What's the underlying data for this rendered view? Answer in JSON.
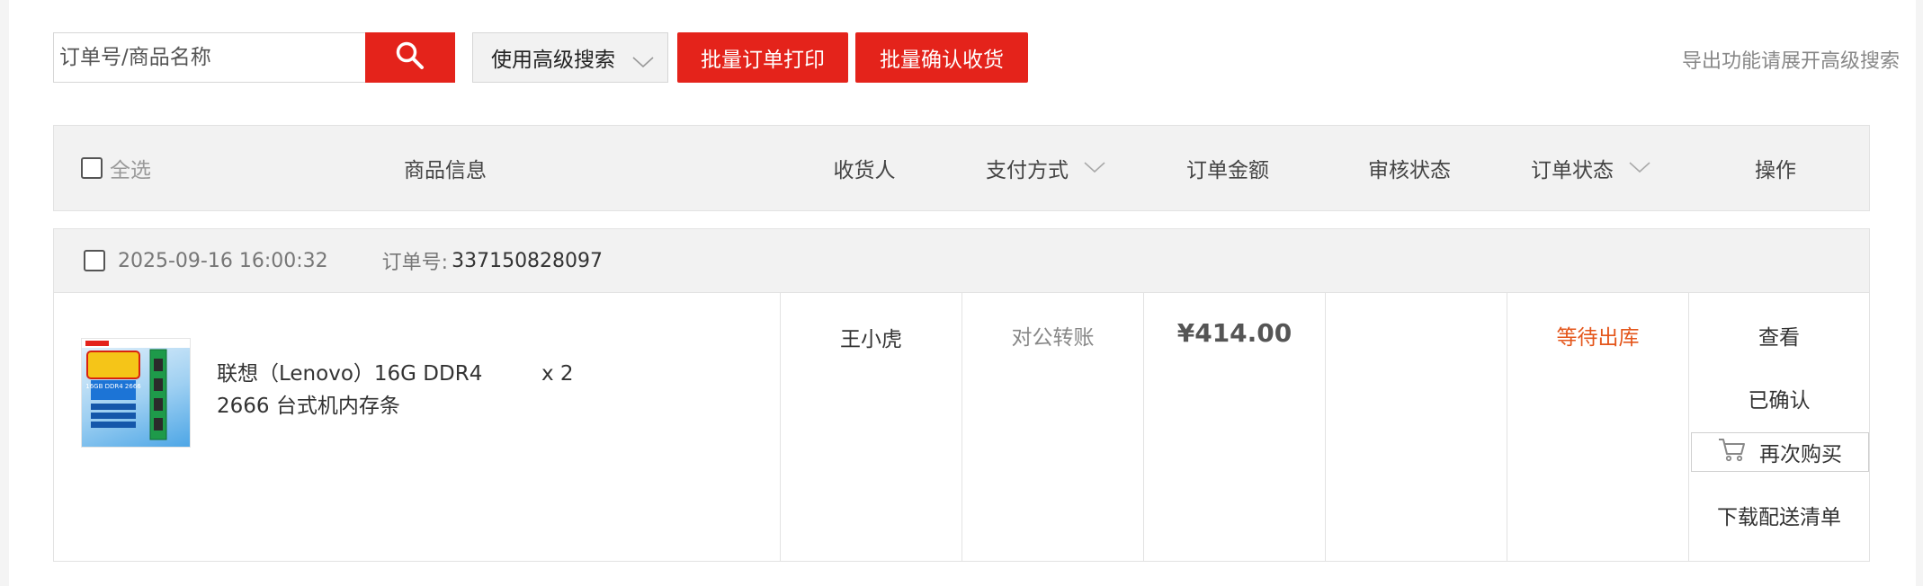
{
  "toolbar": {
    "search_placeholder": "订单号/商品名称",
    "advanced_search_label": "使用高级搜索",
    "batch_print_label": "批量订单打印",
    "batch_confirm_label": "批量确认收货",
    "export_hint": "导出功能请展开高级搜索"
  },
  "table_header": {
    "select_all": "全选",
    "columns": [
      "商品信息",
      "收货人",
      "支付方式",
      "订单金额",
      "审核状态",
      "订单状态",
      "操作"
    ]
  },
  "orders": [
    {
      "datetime": "2025-09-16 16:00:32",
      "order_no_label": "订单号:",
      "order_no": "337150828097",
      "product": {
        "name": "联想（Lenovo）16G DDR4 2666 台式机内存条",
        "quantity": "x 2",
        "image_badge": "16GB DDR4 2666"
      },
      "recipient": "王小虎",
      "payment_method": "对公转账",
      "amount": "¥414.00",
      "review_status": "",
      "order_status": "等待出库",
      "actions": {
        "view": "查看",
        "confirmed": "已确认",
        "rebuy": "再次购买",
        "download": "下载配送清单"
      }
    }
  ],
  "colors": {
    "accent_red": "#e4231b",
    "status_orange": "#e4561b"
  }
}
